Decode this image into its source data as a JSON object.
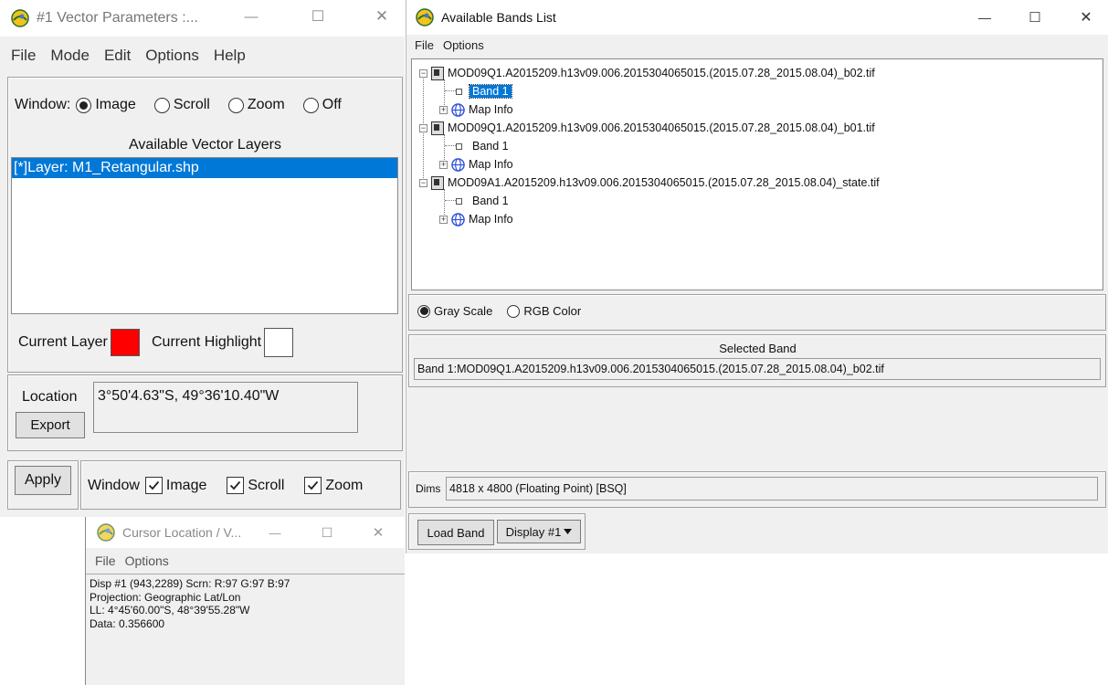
{
  "vector_window": {
    "title": "#1 Vector Parameters :...",
    "menu": [
      "File",
      "Mode",
      "Edit",
      "Options",
      "Help"
    ],
    "window_label": "Window:",
    "window_options": [
      "Image",
      "Scroll",
      "Zoom",
      "Off"
    ],
    "window_selected": "Image",
    "layers_heading": "Available Vector Layers",
    "layers": [
      "[*]Layer: M1_Retangular.shp"
    ],
    "current_layer_label": "Current Layer",
    "current_layer_color": "#ff0000",
    "current_highlight_label": "Current Highlight",
    "current_highlight_color": "#ffffff",
    "location_label": "Location",
    "location_value": "3°50'4.63\"S, 49°36'10.40\"W",
    "export_label": "Export",
    "apply_label": "Apply",
    "window_check_label": "Window",
    "window_checks": [
      "Image",
      "Scroll",
      "Zoom"
    ]
  },
  "cursor_window": {
    "title": "Cursor Location / V...",
    "menu": [
      "File",
      "Options"
    ],
    "lines": [
      "Disp #1 (943,2289) Scrn: R:97 G:97 B:97",
      "Projection: Geographic Lat/Lon",
      "LL: 4°45'60.00\"S, 48°39'55.28\"W",
      "Data: 0.356600"
    ]
  },
  "bands_window": {
    "title": "Available Bands List",
    "menu": [
      "File",
      "Options"
    ],
    "files": [
      {
        "name": "MOD09Q1.A2015209.h13v09.006.2015304065015.(2015.07.28_2015.08.04)_b02.tif",
        "band": "Band 1",
        "info": "Map Info"
      },
      {
        "name": "MOD09Q1.A2015209.h13v09.006.2015304065015.(2015.07.28_2015.08.04)_b01.tif",
        "band": "Band 1",
        "info": "Map Info"
      },
      {
        "name": "MOD09A1.A2015209.h13v09.006.2015304065015.(2015.07.28_2015.08.04)_state.tif",
        "band": "Band 1",
        "info": "Map Info"
      }
    ],
    "color_mode_options": [
      "Gray Scale",
      "RGB Color"
    ],
    "color_mode_selected": "Gray Scale",
    "selected_band_heading": "Selected Band",
    "selected_band_value": "Band 1:MOD09Q1.A2015209.h13v09.006.2015304065015.(2015.07.28_2015.08.04)_b02.tif",
    "dims_label": "Dims",
    "dims_value": "4818 x 4800 (Floating Point) [BSQ]",
    "load_band_label": "Load Band",
    "display_label": "Display #1"
  },
  "colors": {
    "selection_blue": "#0078d7",
    "window_bg": "#f0f0f0"
  },
  "window_controls": {
    "minimize": "—",
    "maximize": "☐",
    "close": "✕"
  }
}
